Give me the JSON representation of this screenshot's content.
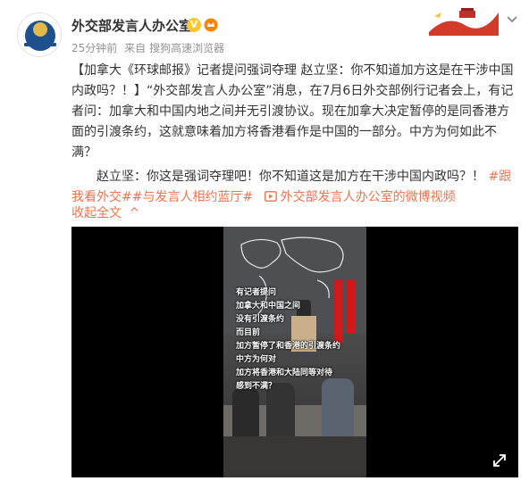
{
  "post": {
    "author": {
      "name": "外交部发言人办公室",
      "verified_mark": "V"
    },
    "meta": {
      "time": "25分钟前",
      "source_prefix": "来自",
      "source": "搜狗高速浏览器"
    },
    "text": {
      "p1_a": "【加拿大《环球邮报》记者提问强词夺理 赵立坚：你不知道加方这是在干涉中国内政吗？！】",
      "p1_b": "“外交部发言人办公室”消息，在7月6日外交部例行记者会上，有记者问：加拿大和中国内地之间并无引渡协议。现在加拿大决定暂停的是同香港方面的引渡条约，这就意味着加方将香港看作是中国的一部分。中方为何如此不满？",
      "p2_a": "赵立坚：你这是强词夺理吧！你不知道这是加方在干涉中国内政吗？！",
      "hashtag1": "#跟我看外交#",
      "hashtag2": "#与发言人相约蓝厅#",
      "video_link": "外交部发言人办公室的微博视频"
    },
    "collapse_label": "收起全文",
    "collapse_arrow": "^"
  },
  "video": {
    "subtitles": [
      "有记者提问",
      "加拿大和中国之间",
      "没有引渡条约",
      "而目前",
      "加方暂停了和香港的引渡条约",
      "中方为何对",
      "加方将香港和大陆同等对待",
      "感到不满？"
    ]
  },
  "icons": {
    "verified": "verified-badge-icon",
    "vip": "vip-crown-icon",
    "menu": "chevron-down-icon",
    "video": "video-play-icon",
    "expand": "fullscreen-expand-icon"
  },
  "colors": {
    "link": "#eb7350",
    "meta": "#939393",
    "verified": "#ffc52a",
    "flag": "#d0191b"
  }
}
